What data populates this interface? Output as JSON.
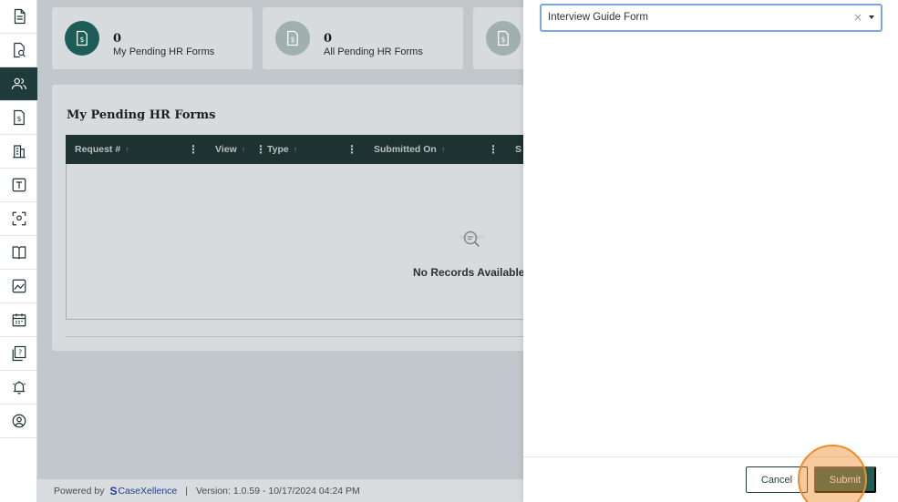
{
  "sidebar": {
    "items": [
      {
        "icon": "document-icon"
      },
      {
        "icon": "document-search-icon"
      },
      {
        "icon": "users-icon"
      },
      {
        "icon": "dollar-document-icon"
      },
      {
        "icon": "building-icon"
      },
      {
        "icon": "text-box-icon"
      },
      {
        "icon": "face-scan-icon"
      },
      {
        "icon": "book-icon"
      },
      {
        "icon": "image-chart-icon"
      },
      {
        "icon": "calendar-icon"
      },
      {
        "icon": "help-document-icon"
      },
      {
        "icon": "alarm-bell-icon"
      },
      {
        "icon": "user-circle-icon"
      }
    ],
    "active_index": 2
  },
  "cards": [
    {
      "count": "0",
      "label": "My Pending HR Forms",
      "circle_color": "#1e5c57"
    },
    {
      "count": "0",
      "label": "All Pending HR Forms",
      "circle_color": "#9fb0ae"
    },
    {
      "count": "",
      "label": "",
      "circle_color": "#9fb0ae"
    }
  ],
  "panel": {
    "title": "My Pending HR Forms",
    "columns": [
      "Request #",
      "View",
      "Type",
      "Submitted On",
      "S"
    ],
    "empty_text": "No Records Available."
  },
  "footer": {
    "powered_by": "Powered by",
    "brand": "CaseXellence",
    "brand_mark": "S",
    "separator": "|",
    "version": "Version: 1.0.59 - 10/17/2024 04:24 PM"
  },
  "drawer": {
    "select_value": "Interview Guide Form",
    "clear_symbol": "×",
    "cancel_label": "Cancel",
    "submit_label": "Submit"
  },
  "colors": {
    "accent": "#1f5e55",
    "grid_header": "#1e3232",
    "focus_border": "#7ea6e0",
    "click_highlight": "#f08b2b"
  }
}
